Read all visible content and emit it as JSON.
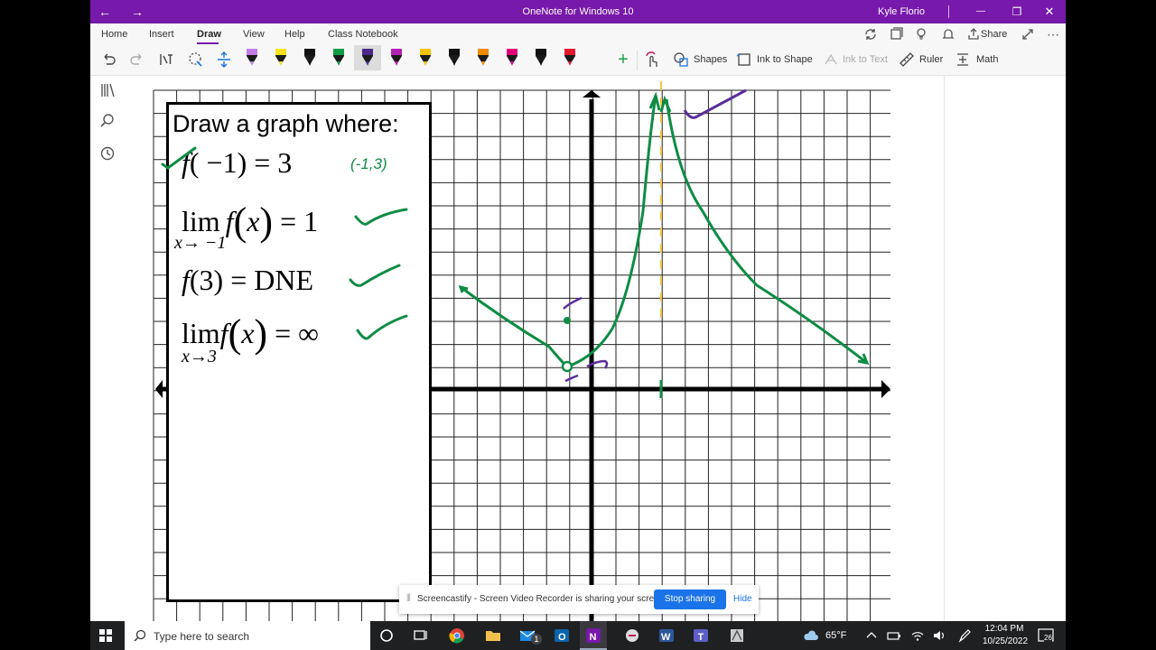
{
  "window": {
    "title": "OneNote for Windows 10",
    "user": "Kyle Florio",
    "back_glyph": "←",
    "forward_glyph": "→",
    "minimize_glyph": "—",
    "maximize_glyph": "❐",
    "close_glyph": "✕"
  },
  "ribbon": {
    "tabs": [
      "Home",
      "Insert",
      "Draw",
      "View",
      "Help",
      "Class Notebook"
    ],
    "active_tab": "Draw",
    "share_label": "Share",
    "tools": {
      "shapes": "Shapes",
      "ink_to_shape": "Ink to Shape",
      "ink_to_text": "Ink to Text",
      "ruler": "Ruler",
      "math": "Math"
    },
    "pen_colors": [
      "#c27ce6",
      "#f5e21b",
      "#111111",
      "#0e9c45",
      "#4b2a8a",
      "#b521b5",
      "#f5c400",
      "#111111",
      "#f08a00",
      "#e3007a",
      "#111111",
      "#e3182d"
    ]
  },
  "prompt": {
    "title": "Draw a graph where:",
    "line1": {
      "f": "f",
      "args": "( −1)",
      "rhs": "= 3"
    },
    "line2": {
      "lim": "lim",
      "sub": "x→ −1",
      "f": "f",
      "x": "x",
      "rhs": "= 1"
    },
    "line3": {
      "f": "f",
      "args": "(3)",
      "rhs": "= DNE"
    },
    "line4": {
      "lim": "lim",
      "sub": "x→3",
      "f": "f",
      "x": "x",
      "rhs": "= ∞"
    }
  },
  "annotation": {
    "point_note": "(-1,3)"
  },
  "share_bar": {
    "text": "Screencastify - Screen Video Recorder is sharing your screen.",
    "stop": "Stop sharing",
    "hide": "Hide"
  },
  "taskbar": {
    "search_placeholder": "Type here to search",
    "weather": "65°F",
    "time": "12:04 PM",
    "date": "10/25/2022",
    "notifications": "26",
    "outlook_badge": "1"
  }
}
